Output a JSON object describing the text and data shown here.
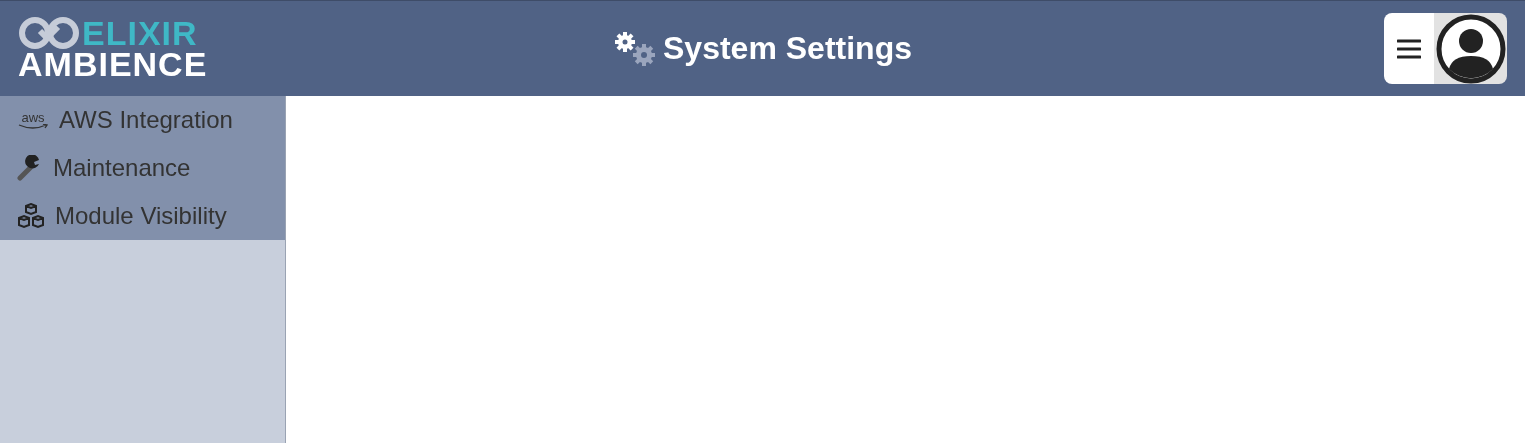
{
  "logo": {
    "line_1": "ELIXIR",
    "line_2": "AMBIENCE"
  },
  "header": {
    "title": "System Settings"
  },
  "sidebar": {
    "items": [
      {
        "kind": "aws",
        "icon_text": "aws",
        "label": "AWS Integration"
      },
      {
        "kind": "wrench",
        "label": "Maintenance"
      },
      {
        "kind": "cubes",
        "label": "Module Visibility"
      }
    ]
  }
}
